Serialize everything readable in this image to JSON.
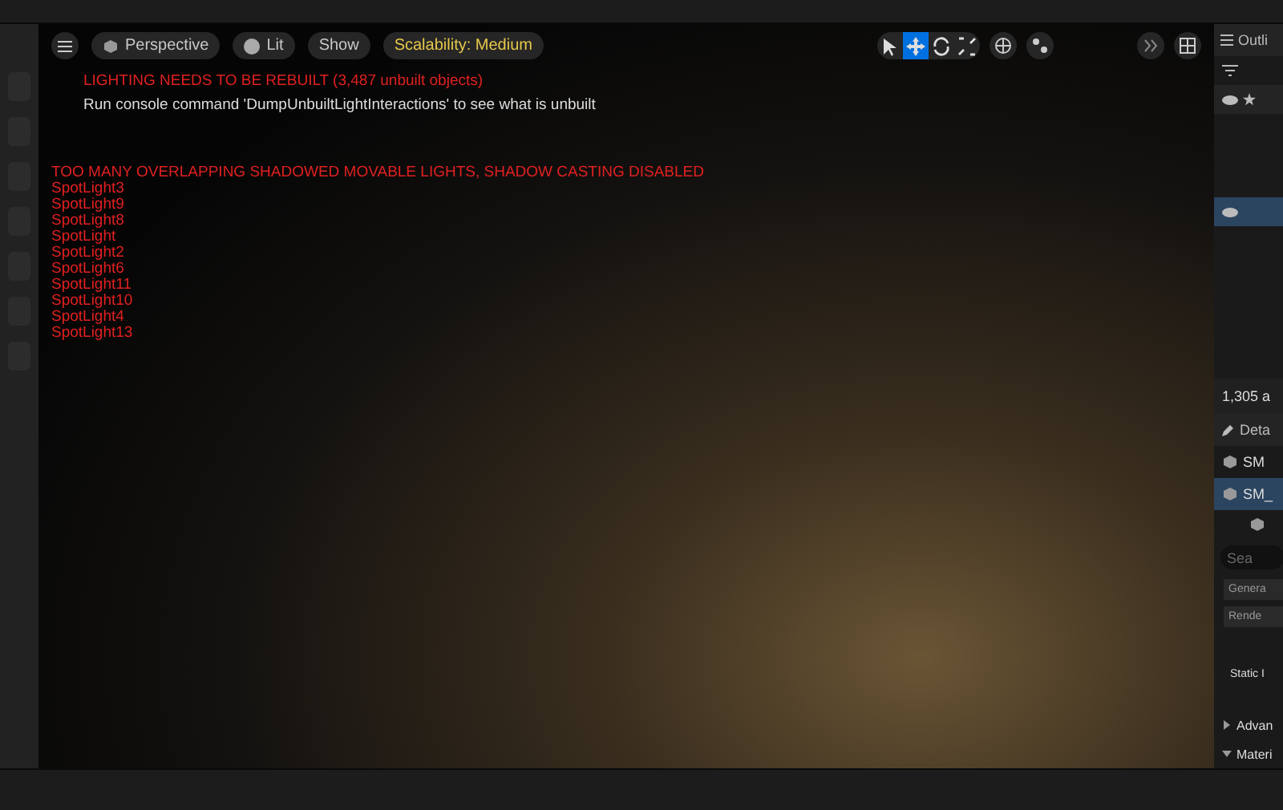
{
  "viewport_toolbar": {
    "perspective": "Perspective",
    "lit": "Lit",
    "show": "Show",
    "scalability": "Scalability: Medium",
    "transform_tools": [
      {
        "kind": "select",
        "selected": false
      },
      {
        "kind": "move",
        "selected": true
      },
      {
        "kind": "rotate",
        "selected": false
      },
      {
        "kind": "scale",
        "selected": false
      }
    ]
  },
  "messages": {
    "lighting_warning": "LIGHTING NEEDS TO BE REBUILT (3,487 unbuilt objects)",
    "console_hint": "Run console command 'DumpUnbuiltLightInteractions' to see what is unbuilt",
    "shadow_warning": "TOO MANY OVERLAPPING SHADOWED MOVABLE LIGHTS, SHADOW CASTING DISABLED",
    "lights": [
      "SpotLight3",
      "SpotLight9",
      "SpotLight8",
      "SpotLight",
      "SpotLight2",
      "SpotLight6",
      "SpotLight11",
      "SpotLight10",
      "SpotLight4",
      "SpotLight13"
    ]
  },
  "outliner": {
    "title": "Outli",
    "count": "1,305 a"
  },
  "details": {
    "title": "Deta",
    "items": [
      {
        "label": "SM",
        "selected": false
      },
      {
        "label": "SM_",
        "selected": true
      }
    ],
    "search_placeholder": "Sea",
    "tabs": [
      "Genera",
      "Rende"
    ],
    "property": "Static I",
    "sections": [
      {
        "label": "Advan",
        "expanded": false
      },
      {
        "label": "Materi",
        "expanded": true
      }
    ]
  }
}
